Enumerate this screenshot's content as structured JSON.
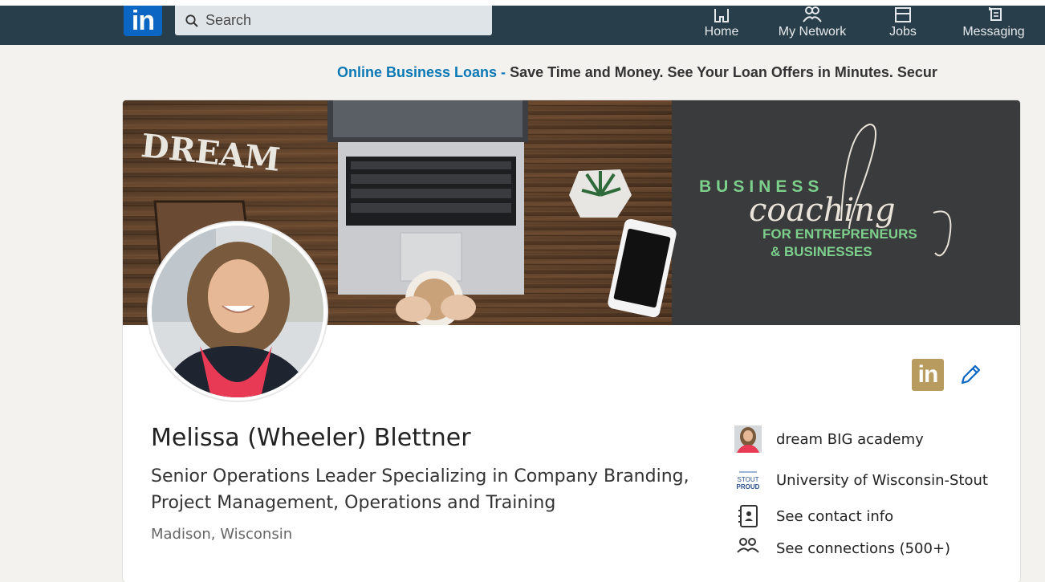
{
  "topbar": {
    "logo_text": "in",
    "search_placeholder": "Search",
    "nav": [
      {
        "label": "Home",
        "icon": "home-icon"
      },
      {
        "label": "My Network",
        "icon": "network-icon"
      },
      {
        "label": "Jobs",
        "icon": "briefcase-icon"
      },
      {
        "label": "Messaging",
        "icon": "messaging-icon"
      }
    ]
  },
  "ad": {
    "link_text": "Online Business Loans -",
    "text": "Save Time and Money. See Your Loan Offers in Minutes. Secur"
  },
  "banner": {
    "dream_text": "DREAM",
    "business_text": "BUSINESS",
    "coaching_text": "coaching",
    "for_line1": "FOR ENTREPRENEURS",
    "for_line2": "& BUSINESSES"
  },
  "profile": {
    "name": "Melissa (Wheeler) Blettner",
    "headline": "Senior Operations Leader Specializing in Company Branding, Project Management, Operations and Training",
    "location": "Madison, Wisconsin",
    "badge_text": "in"
  },
  "sidebar": {
    "items": [
      {
        "label": "dream BIG academy",
        "icon": "company-thumbnail"
      },
      {
        "label": "University of Wisconsin-Stout",
        "icon": "school-logo",
        "logo_top": "STOUT",
        "logo_bottom": "PROUD"
      },
      {
        "label": "See contact info",
        "icon": "contact-card-icon"
      },
      {
        "label": "See connections (500+)",
        "icon": "people-icon"
      }
    ]
  },
  "colors": {
    "topbar": "#283e4a",
    "linkedin_blue": "#0a66c2",
    "ad_link": "#0a79b5",
    "banner_dark": "#3a3b3d",
    "banner_green": "#7dcf8c",
    "badge_gold": "#b89b5e"
  }
}
